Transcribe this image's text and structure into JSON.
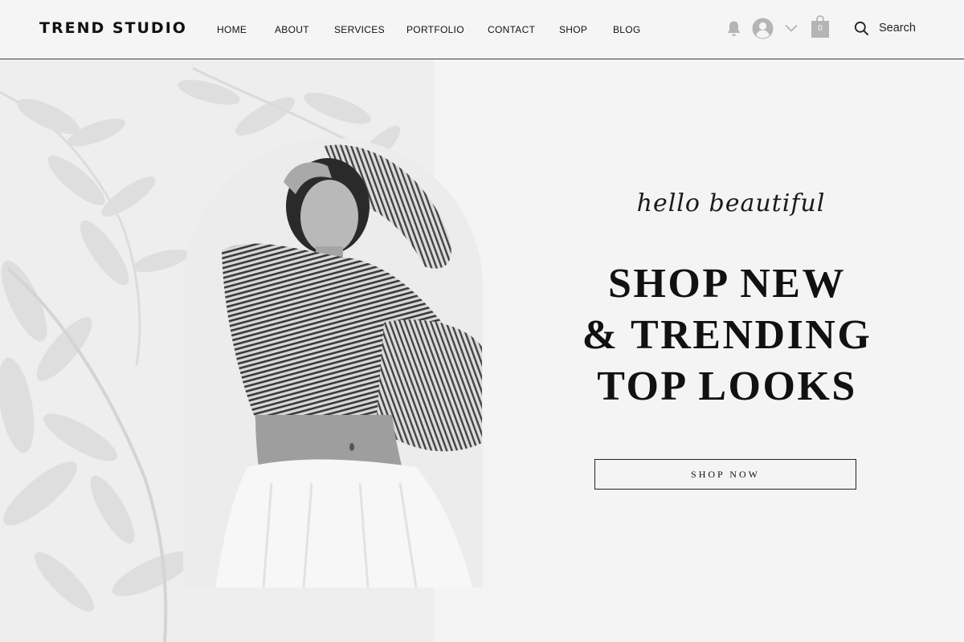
{
  "brand": {
    "name": "TREND STUDIO"
  },
  "nav": {
    "items": [
      {
        "label": "HOME"
      },
      {
        "label": "ABOUT"
      },
      {
        "label": "SERVICES"
      },
      {
        "label": "PORTFOLIO"
      },
      {
        "label": "CONTACT"
      },
      {
        "label": "SHOP"
      },
      {
        "label": "BLOG"
      }
    ]
  },
  "tools": {
    "notification_icon": "bell-icon",
    "avatar_icon": "user-avatar-icon",
    "dropdown_icon": "chevron-down-icon",
    "cart_icon": "shopping-bag-icon",
    "cart_count": "0",
    "search_icon": "search-icon",
    "search_label": "Search"
  },
  "hero": {
    "tagline": "hello beautiful",
    "headline": [
      "SHOP NEW",
      "& TRENDING",
      "TOP LOOKS"
    ],
    "cta_label": "SHOP NOW",
    "image": "black-and-white-fashion-model-photo"
  },
  "colors": {
    "background": "#f4f4f4",
    "text": "#111111",
    "icon_gray": "#b5b5b5",
    "divider": "#3a3a3a"
  }
}
